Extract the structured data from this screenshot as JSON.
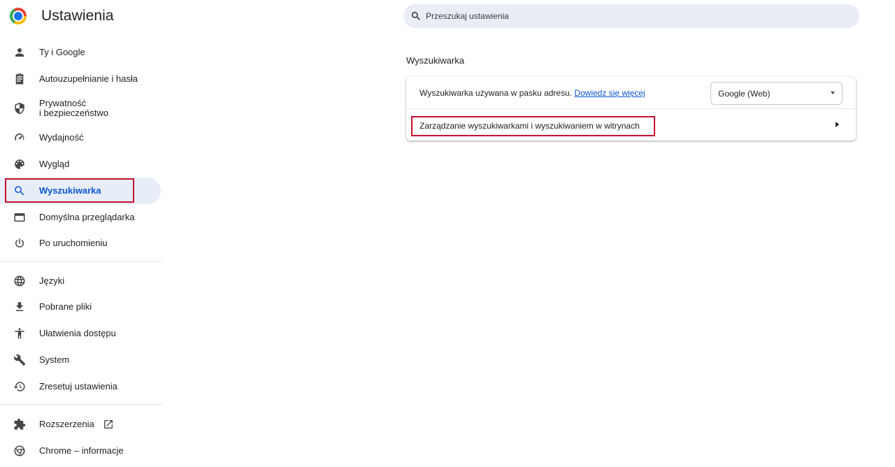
{
  "header": {
    "title": "Ustawienia"
  },
  "search": {
    "placeholder": "Przeszukaj ustawienia"
  },
  "sidebar": {
    "items": [
      {
        "label": "Ty i Google"
      },
      {
        "label": "Autouzupełnianie i hasła"
      },
      {
        "label": "Prywatność\ni bezpieczeństwo"
      },
      {
        "label": "Wydajność"
      },
      {
        "label": "Wygląd"
      },
      {
        "label": "Wyszukiwarka"
      },
      {
        "label": "Domyślna przeglądarka"
      },
      {
        "label": "Po uruchomieniu"
      },
      {
        "label": "Języki"
      },
      {
        "label": "Pobrane pliki"
      },
      {
        "label": "Ułatwienia dostępu"
      },
      {
        "label": "System"
      },
      {
        "label": "Zresetuj ustawienia"
      },
      {
        "label": "Rozszerzenia"
      },
      {
        "label": "Chrome – informacje"
      }
    ]
  },
  "main": {
    "section_title": "Wyszukiwarka",
    "engine_row": {
      "text": "Wyszukiwarka używana w pasku adresu.",
      "link": "Dowiedz się więcej",
      "selected_value": "Google (Web)"
    },
    "manage_row": {
      "label": "Zarządzanie wyszukiwarkami i wyszukiwaniem w witrynach"
    }
  },
  "colors": {
    "accent": "#0b57d0",
    "active_bg": "#e8eef9",
    "highlight": "#c8102e"
  }
}
